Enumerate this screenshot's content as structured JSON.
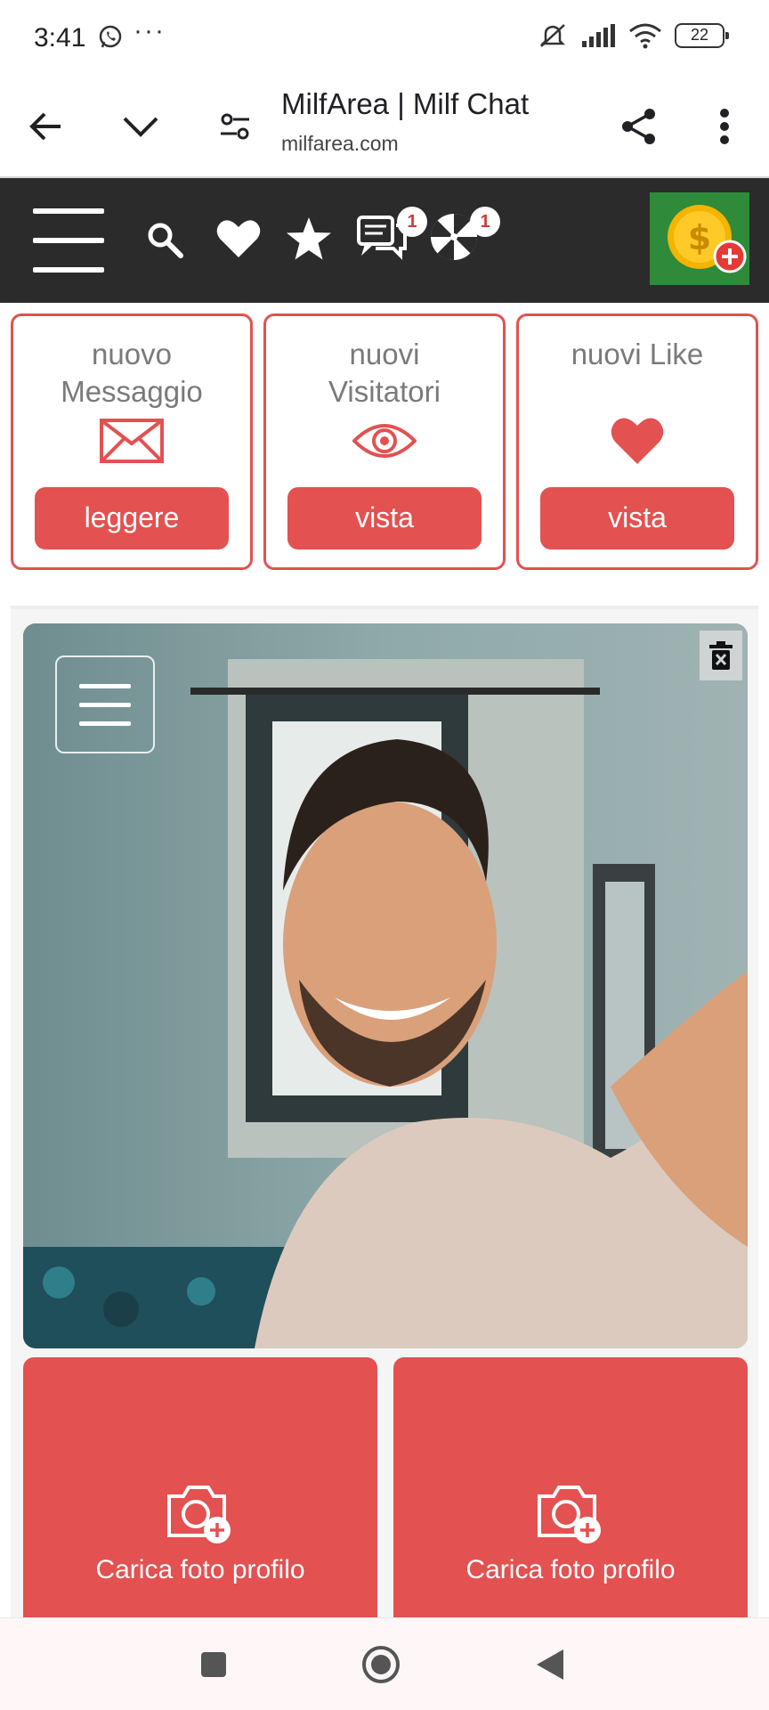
{
  "status_bar": {
    "time": "3:41",
    "overflow": "···",
    "battery": "22",
    "icons": [
      "whatsapp-icon",
      "mute-icon",
      "signal-icon",
      "wifi-icon",
      "battery-icon"
    ]
  },
  "browser": {
    "title": "MilfArea | Milf Chat",
    "url": "milfarea.com",
    "icons": [
      "back-arrow-icon",
      "chevron-down-icon",
      "tune-icon",
      "share-icon",
      "more-vert-icon"
    ]
  },
  "site_nav": {
    "chat_badge": "1",
    "roulette_badge": "1",
    "icons": [
      "hamburger-icon",
      "search-icon",
      "heart-icon",
      "star-icon",
      "chat-icon",
      "roulette-icon",
      "coin-icon"
    ],
    "coin_panel_color": "#2f8a3a"
  },
  "cards": [
    {
      "title_line1": "nuovo",
      "title_line2": "Messaggio",
      "icon": "envelope-icon",
      "button": "leggere"
    },
    {
      "title_line1": "nuovi",
      "title_line2": "Visitatori",
      "icon": "eye-icon",
      "button": "vista"
    },
    {
      "title_line1": "nuovi Like",
      "title_line2": "",
      "icon": "heart-icon",
      "button": "vista"
    }
  ],
  "uploads": [
    {
      "label": "Carica foto profilo",
      "icon": "camera-plus-icon"
    },
    {
      "label": "Carica foto profilo",
      "icon": "camera-plus-icon"
    }
  ],
  "colors": {
    "accent": "#e35151",
    "nav_bg": "#2b2b2b",
    "card_title": "#7a7a7a"
  }
}
